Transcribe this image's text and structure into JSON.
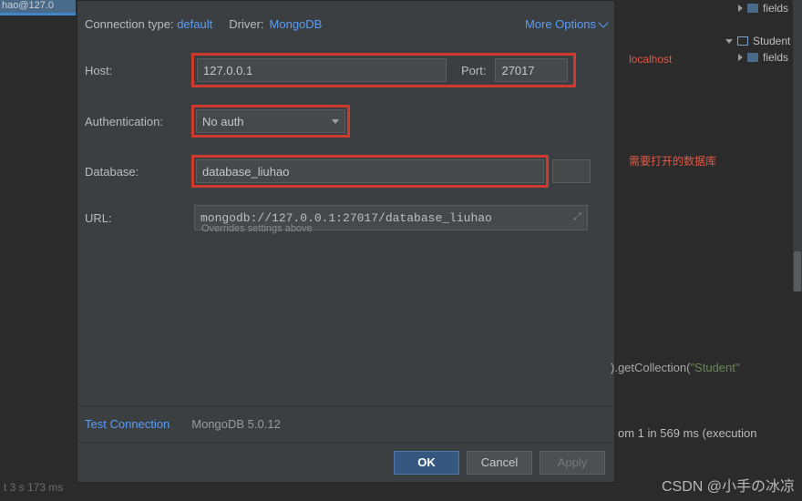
{
  "tab": {
    "title": "hao@127.0"
  },
  "header": {
    "connection_type_label": "Connection type:",
    "connection_type_value": "default",
    "driver_label": "Driver:",
    "driver_value": "MongoDB",
    "more_options": "More Options"
  },
  "fields": {
    "host_label": "Host:",
    "host_value": "127.0.0.1",
    "port_label": "Port:",
    "port_value": "27017",
    "auth_label": "Authentication:",
    "auth_value": "No auth",
    "db_label": "Database:",
    "db_value": "database_liuhao",
    "url_label": "URL:",
    "url_value": "mongodb://127.0.0.1:27017/database_liuhao",
    "url_hint": "Overrides settings above"
  },
  "footer": {
    "test_connection": "Test Connection",
    "version": "MongoDB 5.0.12"
  },
  "buttons": {
    "ok": "OK",
    "cancel": "Cancel",
    "apply": "Apply"
  },
  "tree": {
    "item_fields_top": "fields",
    "item_student": "Student",
    "item_fields_child": "fields"
  },
  "annotations": {
    "localhost": "localhost",
    "db_note": "需要打开的数据库"
  },
  "console": {
    "get_collection_prefix": ").getCollection(",
    "get_collection_arg": "\"Student\"",
    "result_line": "om 1 in 569 ms (execution"
  },
  "watermark": "CSDN @小手の冰凉",
  "status_bottom": "t 3 s 173 ms"
}
